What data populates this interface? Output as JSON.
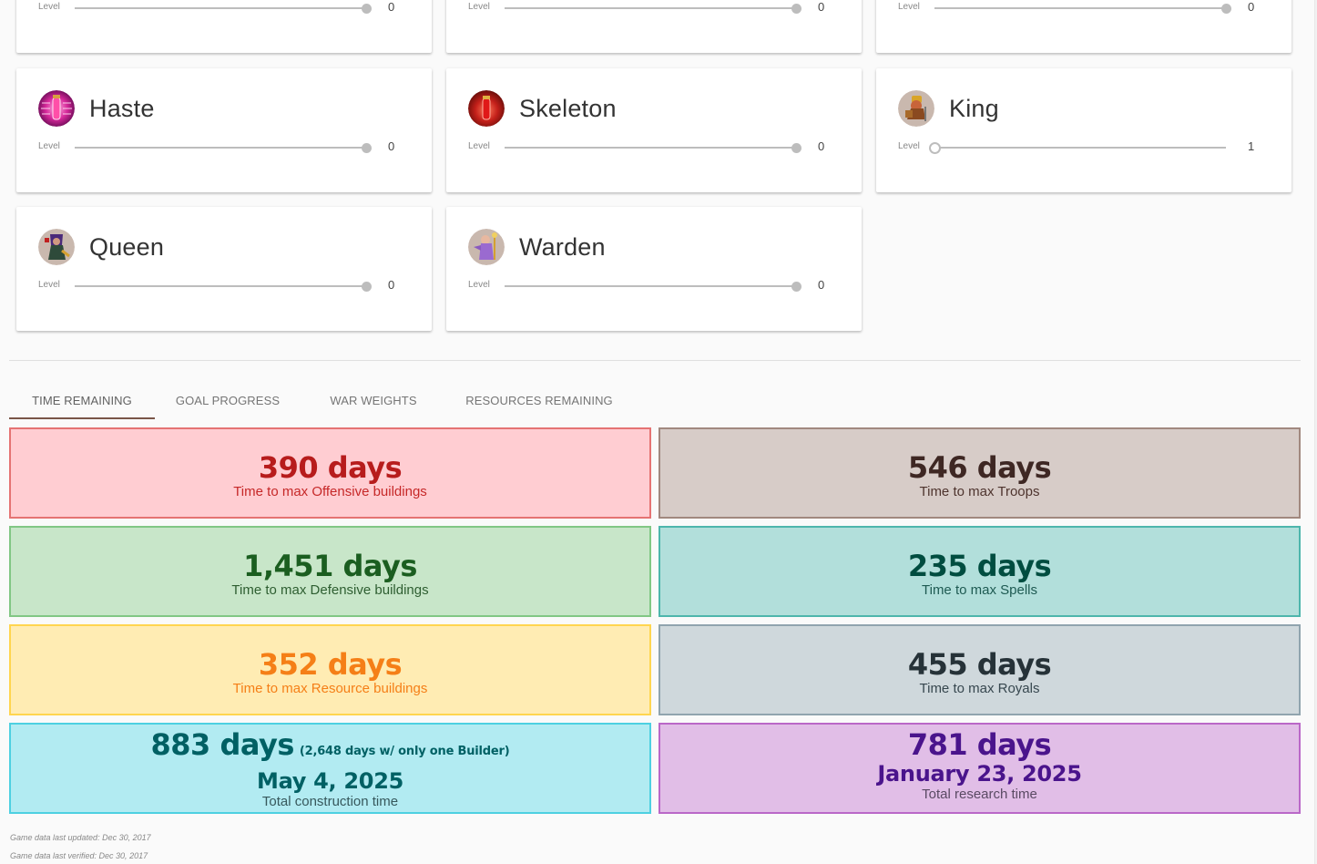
{
  "cards_partial_row": [
    {
      "level_label": "Level",
      "level_value": "0",
      "slider_fraction": 1.0
    },
    {
      "level_label": "Level",
      "level_value": "0",
      "slider_fraction": 1.0
    },
    {
      "level_label": "Level",
      "level_value": "0",
      "slider_fraction": 1.0
    }
  ],
  "cards": [
    {
      "name": "Haste",
      "icon": "haste-spell-icon",
      "level_label": "Level",
      "level_value": "0",
      "slider_fraction": 1.0,
      "knob_style": "filled"
    },
    {
      "name": "Skeleton",
      "icon": "skeleton-spell-icon",
      "level_label": "Level",
      "level_value": "0",
      "slider_fraction": 1.0,
      "knob_style": "filled"
    },
    {
      "name": "King",
      "icon": "barbarian-king-icon",
      "level_label": "Level",
      "level_value": "1",
      "slider_fraction": 0.0,
      "knob_style": "hollow"
    },
    {
      "name": "Queen",
      "icon": "archer-queen-icon",
      "level_label": "Level",
      "level_value": "0",
      "slider_fraction": 1.0,
      "knob_style": "filled"
    },
    {
      "name": "Warden",
      "icon": "grand-warden-icon",
      "level_label": "Level",
      "level_value": "0",
      "slider_fraction": 1.0,
      "knob_style": "filled"
    }
  ],
  "tabs": [
    {
      "label": "TIME REMAINING",
      "active": true
    },
    {
      "label": "GOAL PROGRESS",
      "active": false
    },
    {
      "label": "WAR WEIGHTS",
      "active": false
    },
    {
      "label": "RESOURCES REMAINING",
      "active": false
    }
  ],
  "stats": {
    "offensive": {
      "value": "390 days",
      "label": "Time to max Offensive buildings"
    },
    "troops": {
      "value": "546 days",
      "label": "Time to max Troops"
    },
    "defensive": {
      "value": "1,451 days",
      "label": "Time to max Defensive buildings"
    },
    "spells": {
      "value": "235 days",
      "label": "Time to max Spells"
    },
    "resource": {
      "value": "352 days",
      "label": "Time to max Resource buildings"
    },
    "royals": {
      "value": "455 days",
      "label": "Time to max Royals"
    },
    "construction": {
      "value": "883 days",
      "note": "(2,648 days w/ only one Builder)",
      "date": "May 4, 2025",
      "label": "Total construction time"
    },
    "research": {
      "value": "781 days",
      "date": "January 23, 2025",
      "label": "Total research time"
    }
  },
  "colors": {
    "tab_indicator": "#795548",
    "offensive": "#ffcdd2",
    "troops": "#d7ccc8",
    "defensive": "#c8e6c9",
    "spells": "#b2dfdb",
    "resource": "#ffecb3",
    "royals": "#cfd8dc",
    "construction": "#b2ebf2",
    "research": "#e1bee7"
  },
  "footer": {
    "updated": "Game data last updated: Dec 30, 2017",
    "verified": "Game data last verified: Dec 30, 2017"
  }
}
